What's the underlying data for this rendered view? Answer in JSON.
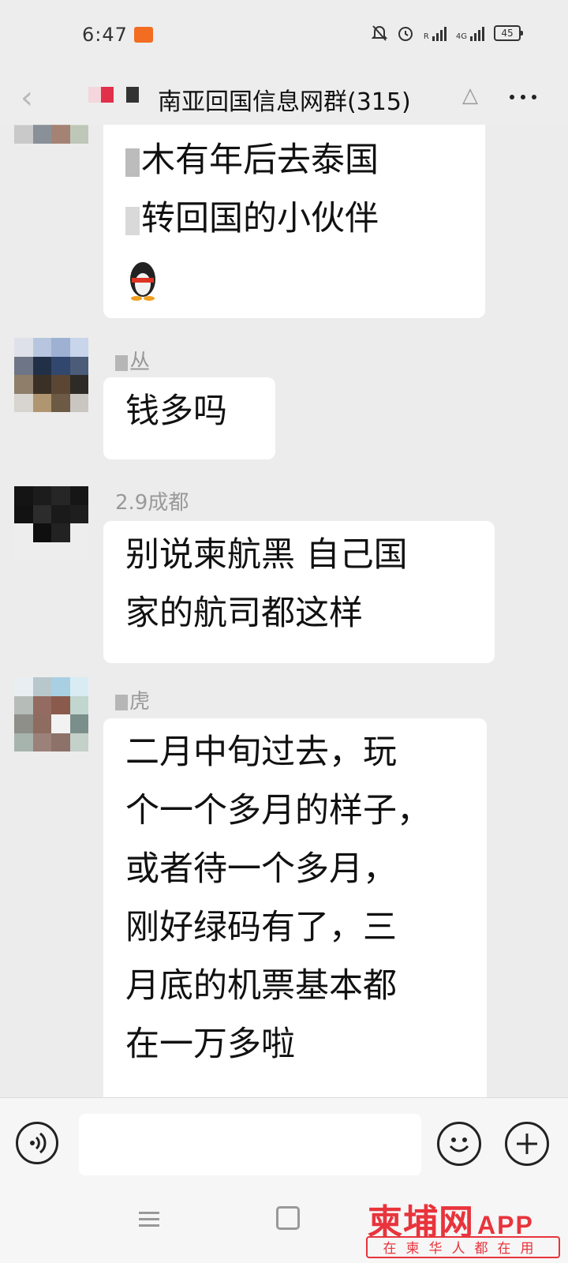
{
  "status_bar": {
    "time": "6:47",
    "battery": "45",
    "network": "4G",
    "roaming": "R"
  },
  "header": {
    "title": "南亚回国信息网群(315)"
  },
  "messages": [
    {
      "lines": [
        "木有年后去泰国",
        "转回国的小伙伴"
      ],
      "emoji": "penguin"
    },
    {
      "sender": "丛",
      "lines": [
        "钱多吗"
      ]
    },
    {
      "sender": "2.9成都",
      "lines": [
        "别说柬航黑 自己国",
        "家的航司都这样"
      ]
    },
    {
      "sender": "虎",
      "lines": [
        "二月中旬过去，玩",
        "个一个多月的样子，",
        "或者待一个多月，",
        "刚好绿码有了，三",
        "月底的机票基本都",
        "在一万多啦"
      ]
    }
  ],
  "watermark": {
    "logo": "柬埔网",
    "app": "APP",
    "slogan": "在柬华人都在用"
  },
  "colors": {
    "accent": "#e8343c",
    "bubble": "#ffffff",
    "background": "#ececec"
  }
}
